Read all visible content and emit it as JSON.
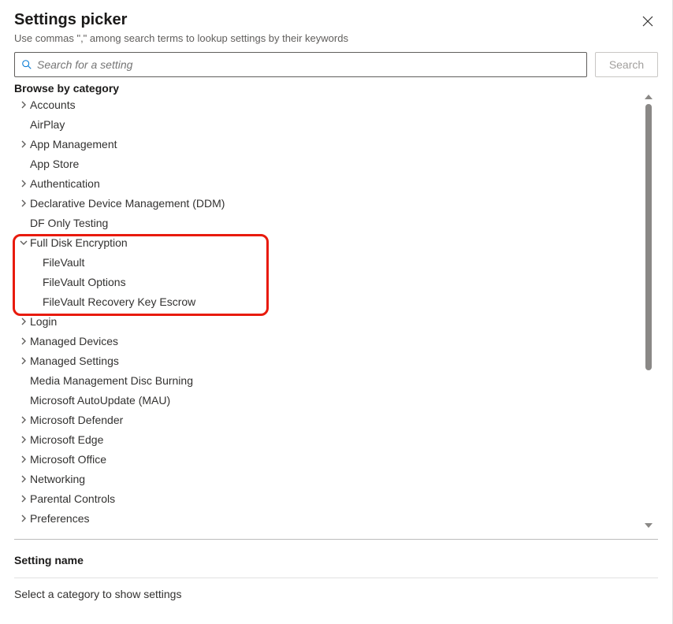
{
  "header": {
    "title": "Settings picker",
    "subtitle": "Use commas \",\" among search terms to lookup settings by their keywords"
  },
  "search": {
    "placeholder": "Search for a setting",
    "button_label": "Search"
  },
  "browse_label": "Browse by category",
  "categories": [
    {
      "label": "Accounts",
      "expandable": true,
      "expanded": false
    },
    {
      "label": "AirPlay",
      "expandable": false
    },
    {
      "label": "App Management",
      "expandable": true,
      "expanded": false
    },
    {
      "label": "App Store",
      "expandable": false
    },
    {
      "label": "Authentication",
      "expandable": true,
      "expanded": false
    },
    {
      "label": "Declarative Device Management (DDM)",
      "expandable": true,
      "expanded": false
    },
    {
      "label": "DF Only Testing",
      "expandable": false
    },
    {
      "label": "Full Disk Encryption",
      "expandable": true,
      "expanded": true,
      "children": [
        {
          "label": "FileVault"
        },
        {
          "label": "FileVault Options"
        },
        {
          "label": "FileVault Recovery Key Escrow"
        }
      ]
    },
    {
      "label": "Login",
      "expandable": true,
      "expanded": false
    },
    {
      "label": "Managed Devices",
      "expandable": true,
      "expanded": false
    },
    {
      "label": "Managed Settings",
      "expandable": true,
      "expanded": false
    },
    {
      "label": "Media Management Disc Burning",
      "expandable": false
    },
    {
      "label": "Microsoft AutoUpdate (MAU)",
      "expandable": false
    },
    {
      "label": "Microsoft Defender",
      "expandable": true,
      "expanded": false
    },
    {
      "label": "Microsoft Edge",
      "expandable": true,
      "expanded": false
    },
    {
      "label": "Microsoft Office",
      "expandable": true,
      "expanded": false
    },
    {
      "label": "Networking",
      "expandable": true,
      "expanded": false
    },
    {
      "label": "Parental Controls",
      "expandable": true,
      "expanded": false
    },
    {
      "label": "Preferences",
      "expandable": true,
      "expanded": false
    }
  ],
  "settings_section": {
    "header": "Setting name",
    "empty_message": "Select a category to show settings"
  }
}
